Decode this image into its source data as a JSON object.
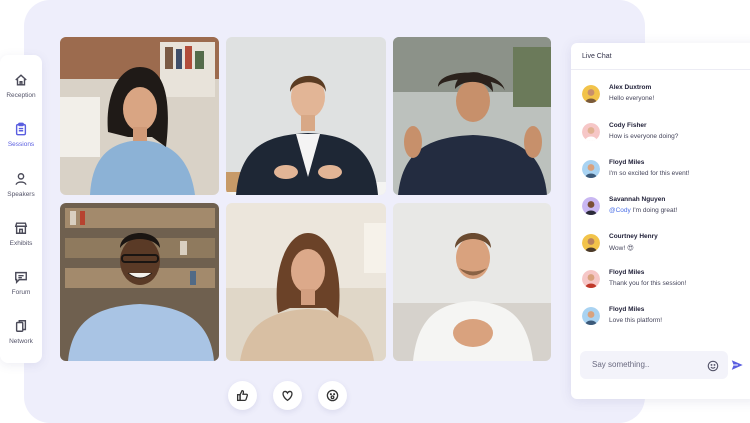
{
  "nav": {
    "items": [
      {
        "label": "Reception",
        "icon": "home-icon"
      },
      {
        "label": "Sessions",
        "icon": "clipboard-icon",
        "active": true
      },
      {
        "label": "Speakers",
        "icon": "person-icon"
      },
      {
        "label": "Exhibits",
        "icon": "storefront-icon"
      },
      {
        "label": "Forum",
        "icon": "chat-bubble-icon"
      },
      {
        "label": "Network",
        "icon": "network-icon"
      }
    ]
  },
  "reactions": [
    "thumbs-up-icon",
    "heart-icon",
    "surprised-face-icon"
  ],
  "chat": {
    "title": "Live Chat",
    "messages": [
      {
        "name": "Alex Duxtrom",
        "text": "Hello everyone!"
      },
      {
        "name": "Cody Fisher",
        "text": "How is everyone doing?"
      },
      {
        "name": "Floyd Miles",
        "text": "I'm so excited for this event!"
      },
      {
        "name": "Savannah Nguyen",
        "mention": "@Cody",
        "text": " I'm doing great!"
      },
      {
        "name": "Courtney Henry",
        "text": "Wow! 😍"
      },
      {
        "name": "Floyd Miles",
        "text": "Thank you for this session!"
      },
      {
        "name": "Floyd Miles",
        "text": "Love this platform!"
      }
    ],
    "input_placeholder": "Say something.."
  },
  "colors": {
    "accent": "#5a5ee0",
    "background": "#eeeefb",
    "mention": "#4b6fe6"
  }
}
